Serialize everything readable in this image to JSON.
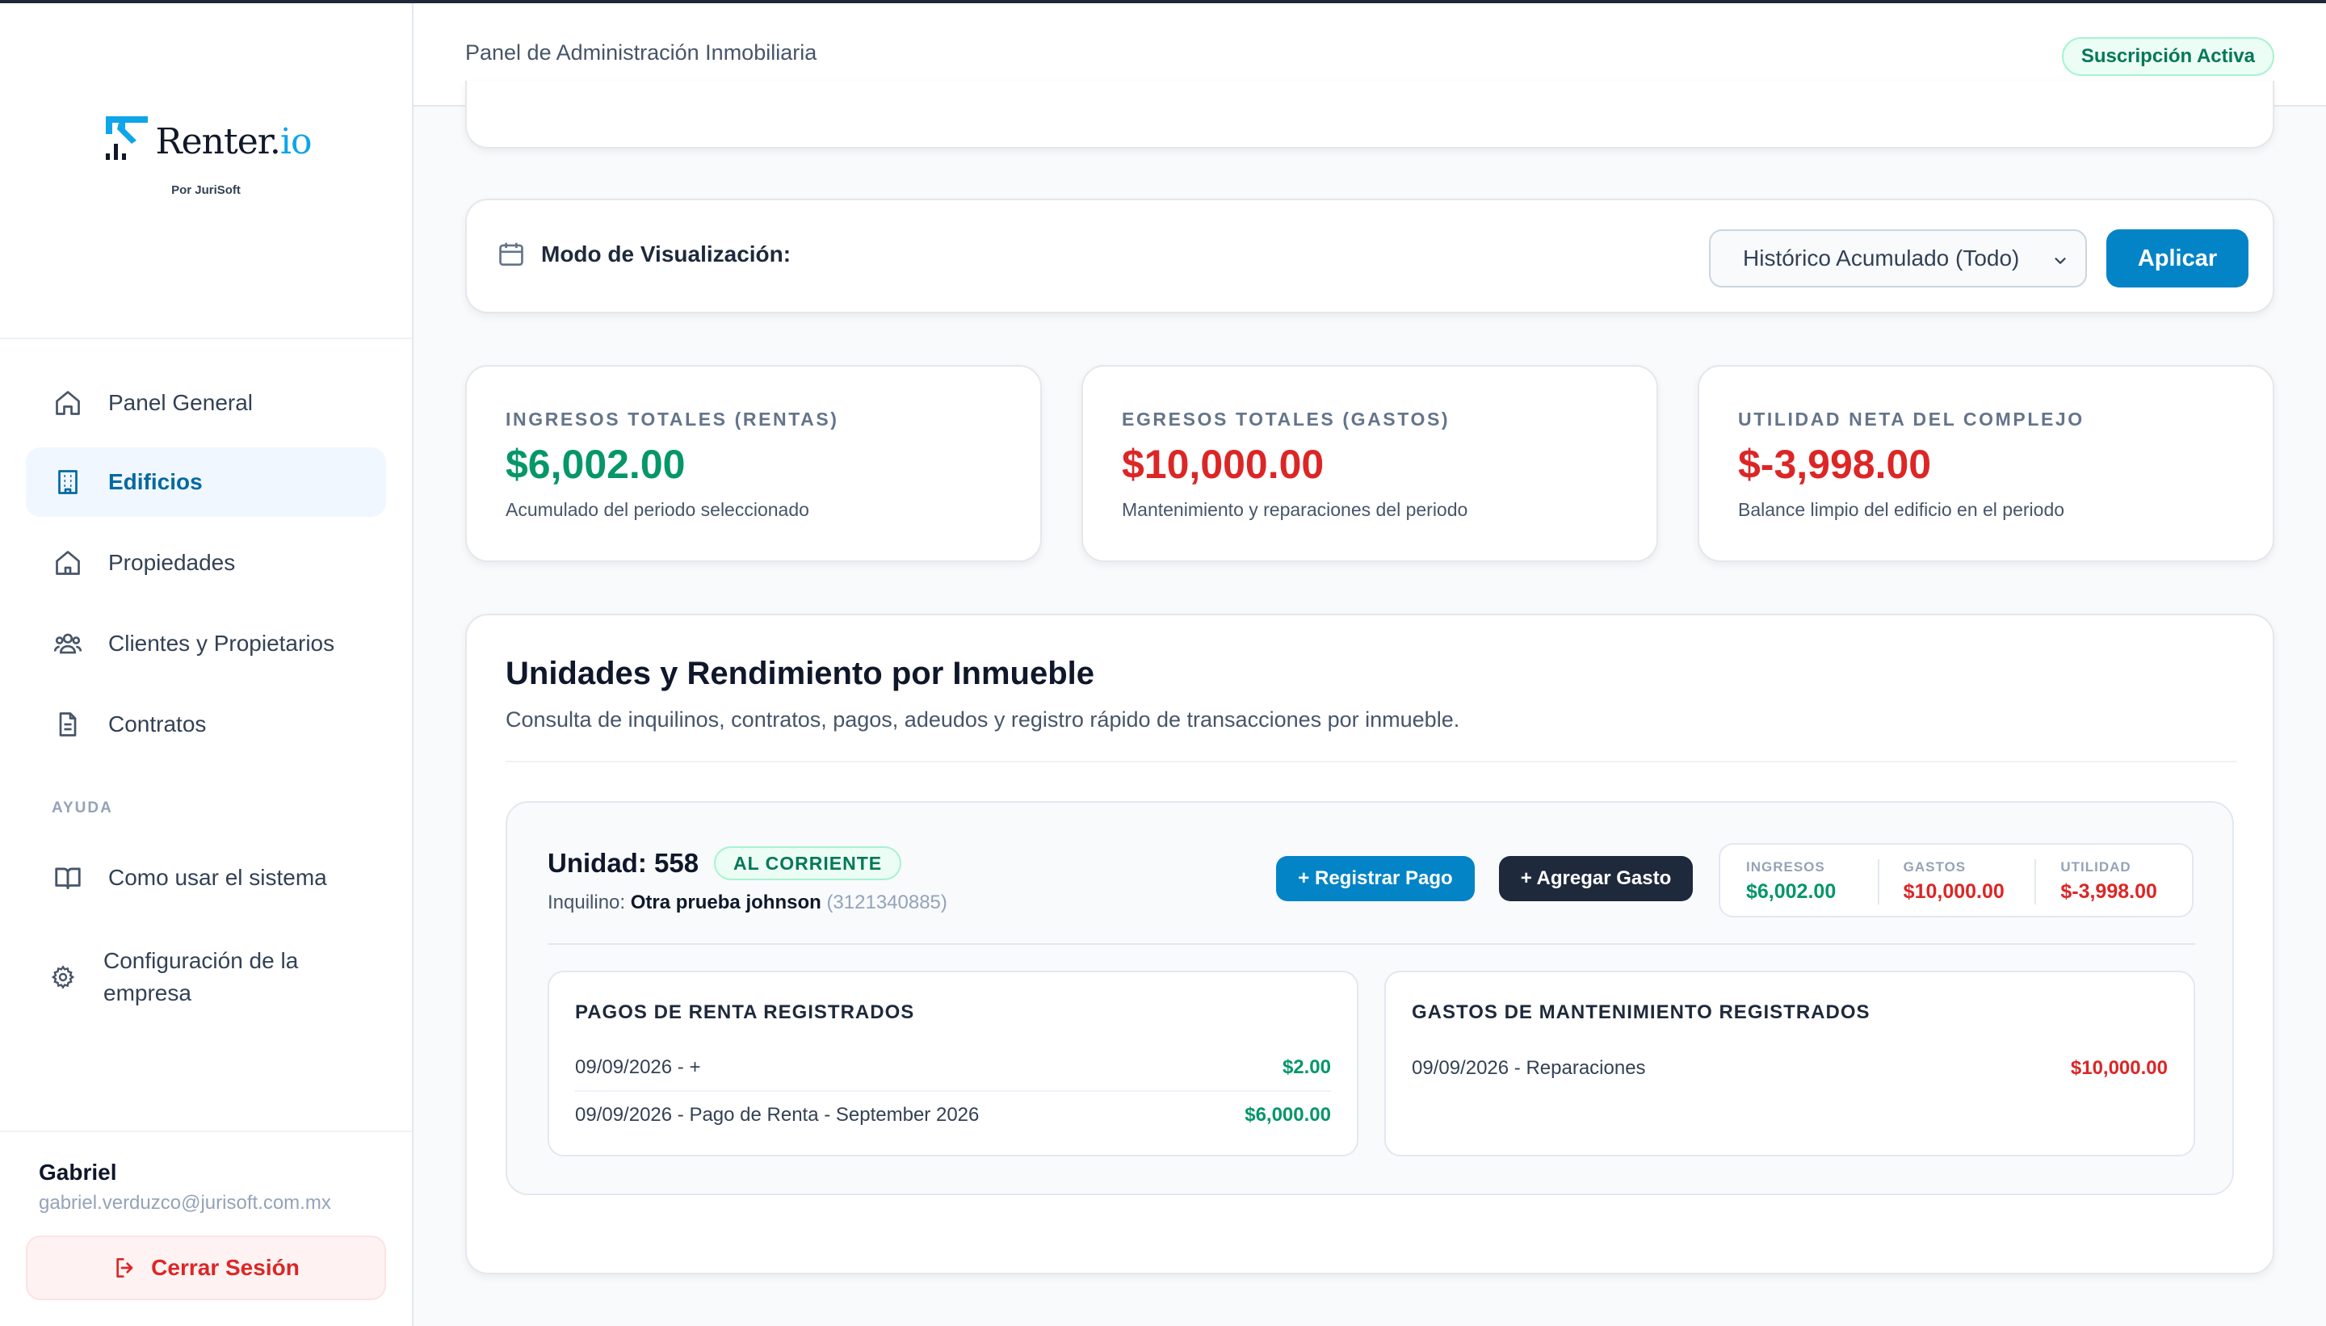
{
  "brand": {
    "name_main": "Renter.",
    "name_suffix": "io",
    "byline": "Por JuriSoft"
  },
  "sidebar": {
    "items": [
      {
        "label": "Panel General",
        "icon": "home-icon"
      },
      {
        "label": "Edificios",
        "icon": "building-icon",
        "active": true
      },
      {
        "label": "Propiedades",
        "icon": "house-icon"
      },
      {
        "label": "Clientes y Propietarios",
        "icon": "users-icon"
      },
      {
        "label": "Contratos",
        "icon": "document-icon"
      }
    ],
    "help_section": "AYUDA",
    "help_items": [
      {
        "label": "Como usar el sistema",
        "icon": "book-icon"
      },
      {
        "label": "Configuración de la empresa",
        "icon": "gear-icon"
      }
    ],
    "user": {
      "name": "Gabriel",
      "email": "gabriel.verduzco@jurisoft.com.mx"
    },
    "logout_label": "Cerrar Sesión"
  },
  "header": {
    "title": "Panel de Administración Inmobiliaria",
    "subscription_badge": "Suscripción Activa"
  },
  "mode": {
    "label": "Modo de Visualización:",
    "selected": "Histórico Acumulado (Todo)",
    "apply_label": "Aplicar"
  },
  "stats": [
    {
      "label": "INGRESOS TOTALES (RENTAS)",
      "value": "$6,002.00",
      "sub": "Acumulado del periodo seleccionado",
      "tone": "green"
    },
    {
      "label": "EGRESOS TOTALES (GASTOS)",
      "value": "$10,000.00",
      "sub": "Mantenimiento y reparaciones del periodo",
      "tone": "red"
    },
    {
      "label": "UTILIDAD NETA DEL COMPLEJO",
      "value": "$-3,998.00",
      "sub": "Balance limpio del edificio en el periodo",
      "tone": "red"
    }
  ],
  "units": {
    "title": "Unidades y Rendimiento por Inmueble",
    "description": "Consulta de inquilinos, contratos, pagos, adeudos y registro rápido de transacciones por inmueble.",
    "unit": {
      "name": "Unidad: 558",
      "status": "AL CORRIENTE",
      "tenant_prefix": "Inquilino:",
      "tenant_name": "Otra prueba johnson",
      "tenant_phone": "(3121340885)",
      "pay_button": "+ Registrar Pago",
      "expense_button": "+ Agregar Gasto",
      "mini": [
        {
          "label": "INGRESOS",
          "value": "$6,002.00"
        },
        {
          "label": "GASTOS",
          "value": "$10,000.00"
        },
        {
          "label": "UTILIDAD",
          "value": "$-3,998.00"
        }
      ],
      "payments": {
        "title": "PAGOS DE RENTA REGISTRADOS",
        "rows": [
          {
            "desc": "09/09/2026 - +",
            "amount": "$2.00"
          },
          {
            "desc": "09/09/2026 - Pago de Renta - September 2026",
            "amount": "$6,000.00"
          }
        ]
      },
      "expenses": {
        "title": "GASTOS DE MANTENIMIENTO REGISTRADOS",
        "rows": [
          {
            "desc": "09/09/2026 - Reparaciones",
            "amount": "$10,000.00"
          }
        ]
      }
    }
  },
  "colors": {
    "accent": "#0284c7",
    "positive": "#059669",
    "negative": "#dc2626",
    "dark_button": "#1e293b"
  }
}
